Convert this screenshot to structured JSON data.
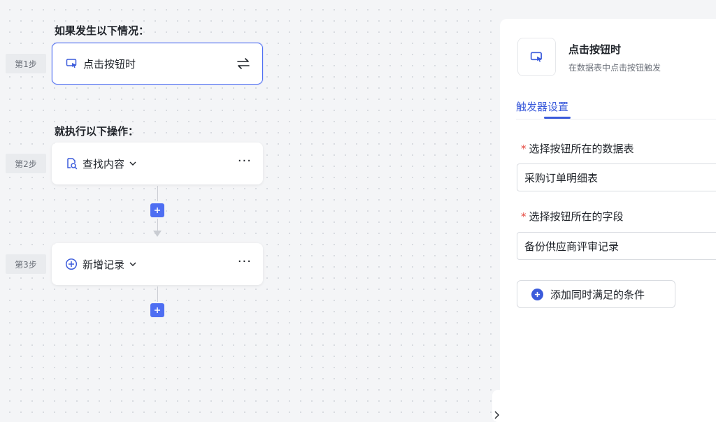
{
  "canvas": {
    "if_title": "如果发生以下情况：",
    "then_title": "就执行以下操作：",
    "steps": [
      {
        "label": "第1步",
        "name": "点击按钮时",
        "icon": "cursor-click-icon"
      },
      {
        "label": "第2步",
        "name": "查找内容",
        "icon": "search-doc-icon"
      },
      {
        "label": "第3步",
        "name": "新增记录",
        "icon": "plus-circle-icon"
      }
    ],
    "more_label": "···"
  },
  "panel": {
    "trigger_title": "点击按钮时",
    "trigger_desc": "在数据表中点击按钮触发",
    "tab_label": "触发器设置",
    "fields": [
      {
        "label": "选择按钮所在的数据表",
        "value": "采购订单明细表"
      },
      {
        "label": "选择按钮所在的字段",
        "value": "备份供应商评审记录"
      }
    ],
    "required_mark": "*",
    "add_condition_label": "添加同时满足的条件"
  },
  "colors": {
    "accent": "#4e6ef2",
    "tab_active": "#3b5bdb",
    "required": "#e5483f"
  }
}
